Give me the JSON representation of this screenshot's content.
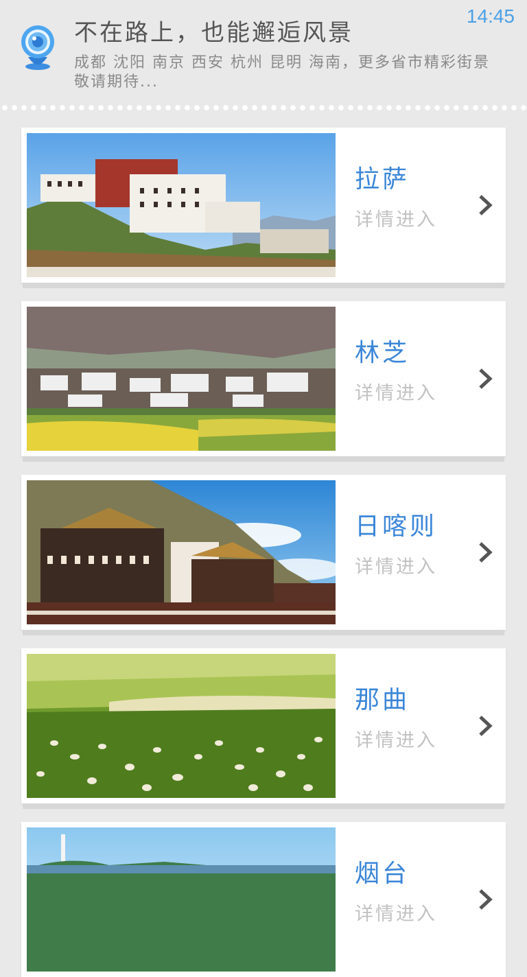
{
  "status_bar": {
    "time": "14:45"
  },
  "header": {
    "title": "不在路上，也能邂逅风景",
    "subtitle": "成都 沈阳 南京 西安 杭州 昆明 海南，更多省市精彩街景敬请期待...",
    "logo_icon": "location-pin-icon"
  },
  "colors": {
    "accent": "#3b86d8",
    "time": "#4aa0e6",
    "background": "#e9e9e9"
  },
  "cities": [
    {
      "name": "拉萨",
      "detail": "详情进入"
    },
    {
      "name": "林芝",
      "detail": "详情进入"
    },
    {
      "name": "日喀则",
      "detail": "详情进入"
    },
    {
      "name": "那曲",
      "detail": "详情进入"
    },
    {
      "name": "烟台",
      "detail": "详情进入"
    }
  ]
}
